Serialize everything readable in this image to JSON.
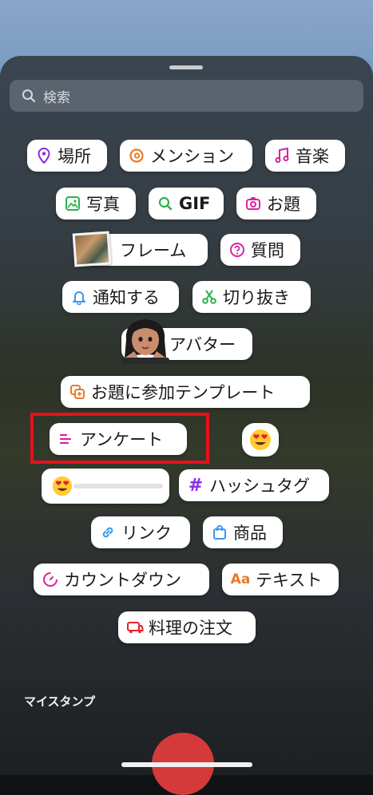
{
  "search": {
    "placeholder": "検索"
  },
  "stickers": {
    "location": "場所",
    "mention": "メンション",
    "music": "音楽",
    "photo": "写真",
    "gif": "GIF",
    "prompt": "お題",
    "frame": "フレーム",
    "question": "質問",
    "notify": "通知する",
    "cutout": "切り抜き",
    "avatar": "アバター",
    "template": "お題に参加テンプレート",
    "poll": "アンケート",
    "hashtag": "ハッシュタグ",
    "link": "リンク",
    "product": "商品",
    "countdown": "カウントダウン",
    "text": "テキスト",
    "food_order": "料理の注文"
  },
  "my_stickers": {
    "title": "マイスタンプ"
  },
  "colors": {
    "highlight": "#e8101c",
    "purple": "#8a2be2",
    "pink": "#d6249f",
    "green": "#2bb24c",
    "blue": "#3897f0"
  }
}
